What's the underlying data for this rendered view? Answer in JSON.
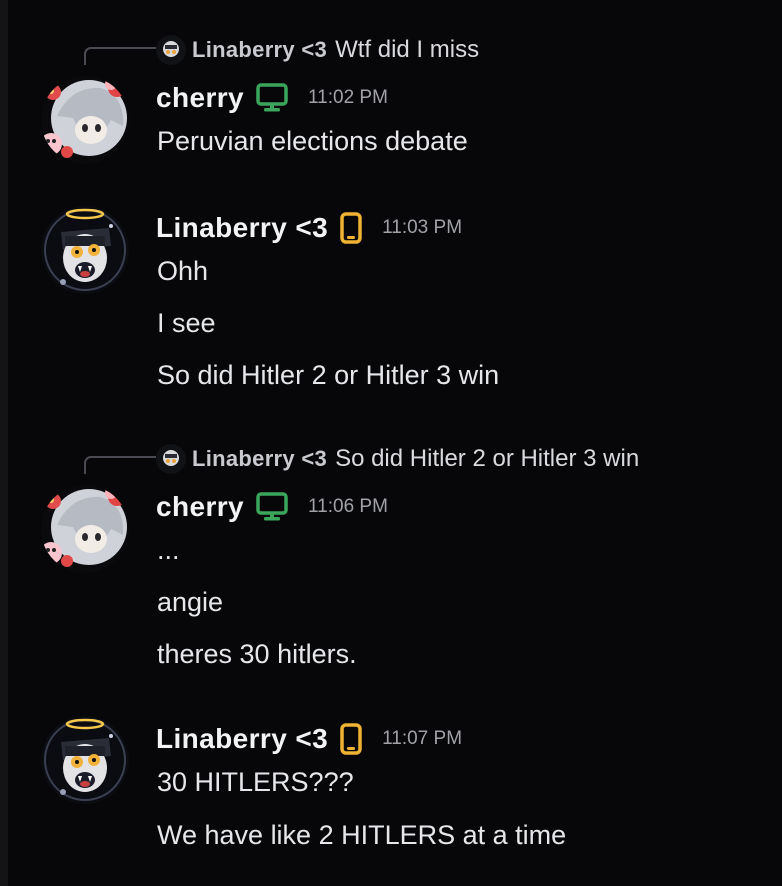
{
  "colors": {
    "background": "#070709",
    "desktop_icon": "#3ba55c",
    "mobile_icon": "#f0b232",
    "username": "#f2f3f5",
    "timestamp": "#a0a2a8"
  },
  "messages": [
    {
      "reply": {
        "author": "Linaberry <3",
        "text": "Wtf did I miss"
      },
      "author": "cherry",
      "device_icon": "desktop-icon",
      "time": "11:02 PM",
      "lines": [
        "Peruvian elections debate"
      ]
    },
    {
      "author": "Linaberry <3",
      "device_icon": "mobile-icon",
      "time": "11:03 PM",
      "lines": [
        "Ohh",
        "I see",
        "So did Hitler 2 or Hitler 3 win"
      ]
    },
    {
      "reply": {
        "author": "Linaberry <3",
        "text": "So did Hitler 2 or Hitler 3 win"
      },
      "author": "cherry",
      "device_icon": "desktop-icon",
      "time": "11:06 PM",
      "lines": [
        "...",
        "angie",
        "theres 30 hitlers."
      ]
    },
    {
      "author": "Linaberry <3",
      "device_icon": "mobile-icon",
      "time": "11:07 PM",
      "lines": [
        "30 HITLERS???",
        "We have like 2 HITLERS at a time"
      ]
    }
  ]
}
